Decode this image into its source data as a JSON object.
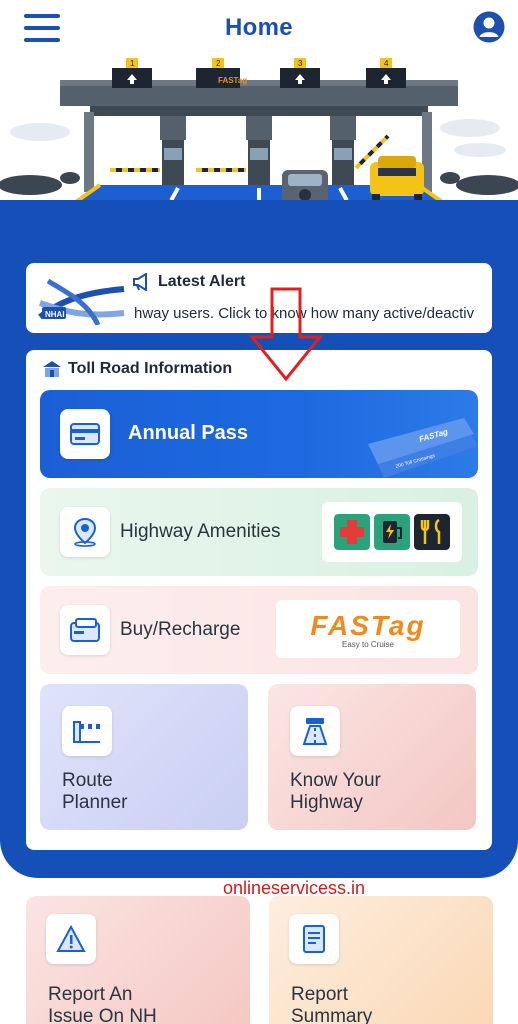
{
  "header": {
    "title": "Home",
    "menu_icon": "hamburger-menu-icon",
    "profile_icon": "user-profile-icon"
  },
  "hero": {
    "booth_numbers": [
      "1",
      "2",
      "3",
      "4"
    ],
    "fastag_sign": "FASTag"
  },
  "alert": {
    "title": "Latest Alert",
    "icon": "megaphone-icon",
    "text": "hway users. Click to know how many active/deactiv",
    "thumb_label": "NHAI"
  },
  "info": {
    "title": "Toll Road Information",
    "icon": "toll-booth-icon",
    "tiles": {
      "annual_pass": "Annual Pass",
      "annual_pass_card_brand": "FASTag",
      "annual_pass_card_caption": "200 Toll Crossings",
      "amenities": "Highway Amenities",
      "buy_recharge": "Buy/Recharge",
      "fastag_logo": "FASTag",
      "fastag_tagline": "Easy to Cruise",
      "route_planner_line1": "Route",
      "route_planner_line2": "Planner",
      "know_highway_line1": "Know Your",
      "know_highway_line2": "Highway"
    }
  },
  "watermark": "onlineservicess.in",
  "bottom": {
    "report_line1": "Report An",
    "report_line2": "Issue On NH",
    "summary_line1": "Report",
    "summary_line2": "Summary"
  },
  "colors": {
    "brand_blue": "#1550b8",
    "title_blue": "#1b4fb0",
    "annual_blue": "#1b5fd6",
    "arrow_red": "#e02020",
    "fastag_orange": "#f08a1c"
  }
}
